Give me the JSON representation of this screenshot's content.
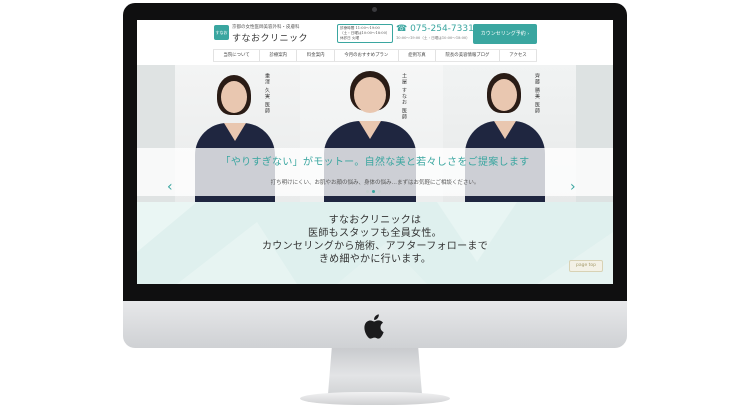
{
  "header": {
    "logo_text": "すなお",
    "tagline": "京都の女性医師美容外科・皮膚科",
    "site_name": "すなおクリニック",
    "hours_lines": [
      "診療時間 11:00〜19:00",
      "（土・日曜は10:00〜18:00）",
      "休診日 火曜"
    ],
    "tel": "075-254-7331",
    "tel_sub": "10:00〜19:00（土・日曜は10:00〜18:00）",
    "reserve_button": "カウンセリング予約"
  },
  "nav": {
    "items": [
      "当院について",
      "診療案内",
      "料金案内",
      "今月のおすすめプラン",
      "症例写真",
      "院長の美容情報ブログ",
      "アクセス"
    ]
  },
  "hero": {
    "doctors": [
      {
        "name": "重澤 久実 医師"
      },
      {
        "name": "土屋 すなお 医師"
      },
      {
        "name": "齊藤 勝美 医師"
      }
    ],
    "headline": "「やりすぎない」がモットー。自然な美と若々しさをご提案します",
    "subtext": "打ち明けにくい、お肌やお顔の悩み、身体の悩み…まずはお気軽にご相談ください。",
    "prev_arrow": "‹",
    "next_arrow": "›",
    "slide_count": 3,
    "active_slide": 1
  },
  "intro": {
    "lines": [
      "すなおクリニックは",
      "医師もスタッフも全員女性。",
      "カウンセリングから施術、アフターフォローまで",
      "きめ細やかに行います。"
    ],
    "page_top": "page top"
  },
  "colors": {
    "accent": "#3aa6a0",
    "scrubs": "#1f2640",
    "intro_bg": "#dff0ee"
  }
}
